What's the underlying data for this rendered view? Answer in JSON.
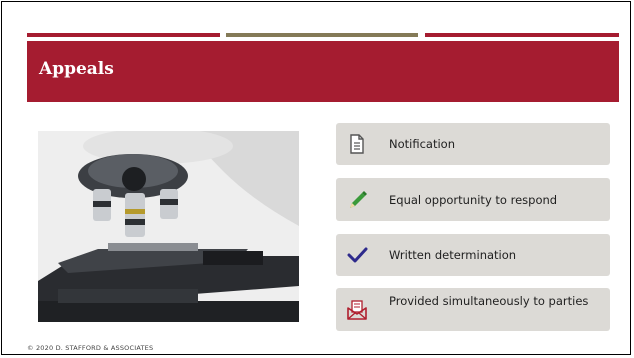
{
  "slide": {
    "title": "Appeals",
    "footer": "© 2020 D. STAFFORD & ASSOCIATES"
  },
  "colors": {
    "banner": "#a51c30",
    "bar_left": "#a51c30",
    "bar_middle": "#847a57",
    "bar_right": "#a51c30",
    "card_bg": "#dcdad6",
    "pencil": "#3a9a3a",
    "check": "#2e2a8c",
    "envelope": "#b01e2e"
  },
  "photo": {
    "subject": "microscope"
  },
  "items": [
    {
      "label": "Notification",
      "icon": "document-icon"
    },
    {
      "label": "Equal opportunity to respond",
      "icon": "pencil-icon"
    },
    {
      "label": "Written determination",
      "icon": "checkmark-icon"
    },
    {
      "label": "Provided simultaneously to parties",
      "icon": "envelope-letter-icon"
    }
  ]
}
